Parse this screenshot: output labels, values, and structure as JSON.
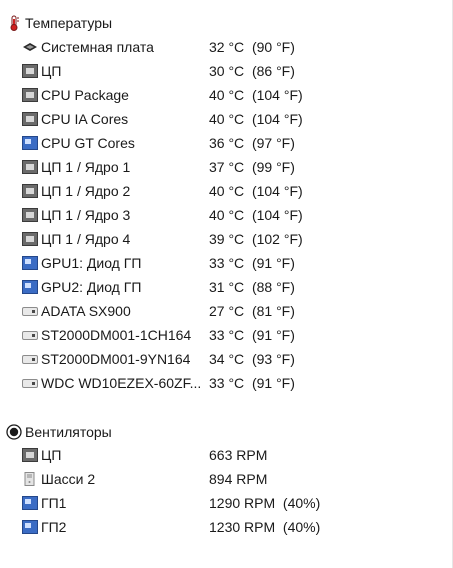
{
  "temperatures": {
    "title": "Температуры",
    "icon": "thermometer-icon",
    "items": [
      {
        "name": "Системная плата",
        "value": "32 °C  (90 °F)",
        "icon": "motherboard-icon"
      },
      {
        "name": "ЦП",
        "value": "30 °C  (86 °F)",
        "icon": "cpu-chip-icon"
      },
      {
        "name": "CPU Package",
        "value": "40 °C  (104 °F)",
        "icon": "cpu-chip-icon"
      },
      {
        "name": "CPU IA Cores",
        "value": "40 °C  (104 °F)",
        "icon": "cpu-chip-icon"
      },
      {
        "name": "CPU GT Cores",
        "value": "36 °C  (97 °F)",
        "icon": "gpu-icon"
      },
      {
        "name": "ЦП 1 / Ядро 1",
        "value": "37 °C  (99 °F)",
        "icon": "cpu-chip-icon"
      },
      {
        "name": "ЦП 1 / Ядро 2",
        "value": "40 °C  (104 °F)",
        "icon": "cpu-chip-icon"
      },
      {
        "name": "ЦП 1 / Ядро 3",
        "value": "40 °C  (104 °F)",
        "icon": "cpu-chip-icon"
      },
      {
        "name": "ЦП 1 / Ядро 4",
        "value": "39 °C  (102 °F)",
        "icon": "cpu-chip-icon"
      },
      {
        "name": "GPU1: Диод ГП",
        "value": "33 °C  (91 °F)",
        "icon": "gpu-icon"
      },
      {
        "name": "GPU2: Диод ГП",
        "value": "31 °C  (88 °F)",
        "icon": "gpu-icon"
      },
      {
        "name": "ADATA SX900",
        "value": "27 °C  (81 °F)",
        "icon": "disk-drive-icon"
      },
      {
        "name": "ST2000DM001-1CH164",
        "value": "33 °C  (91 °F)",
        "icon": "disk-drive-icon"
      },
      {
        "name": "ST2000DM001-9YN164",
        "value": "34 °C  (93 °F)",
        "icon": "disk-drive-icon"
      },
      {
        "name": "WDC WD10EZEX-60ZF...",
        "value": "33 °C  (91 °F)",
        "icon": "disk-drive-icon"
      }
    ]
  },
  "fans": {
    "title": "Вентиляторы",
    "icon": "fan-icon",
    "items": [
      {
        "name": "ЦП",
        "value": "663 RPM",
        "icon": "cpu-chip-icon"
      },
      {
        "name": "Шасси 2",
        "value": "894 RPM",
        "icon": "chassis-icon"
      },
      {
        "name": "ГП1",
        "value": "1290 RPM  (40%)",
        "icon": "gpu-icon"
      },
      {
        "name": "ГП2",
        "value": "1230 RPM  (40%)",
        "icon": "gpu-icon"
      }
    ]
  }
}
